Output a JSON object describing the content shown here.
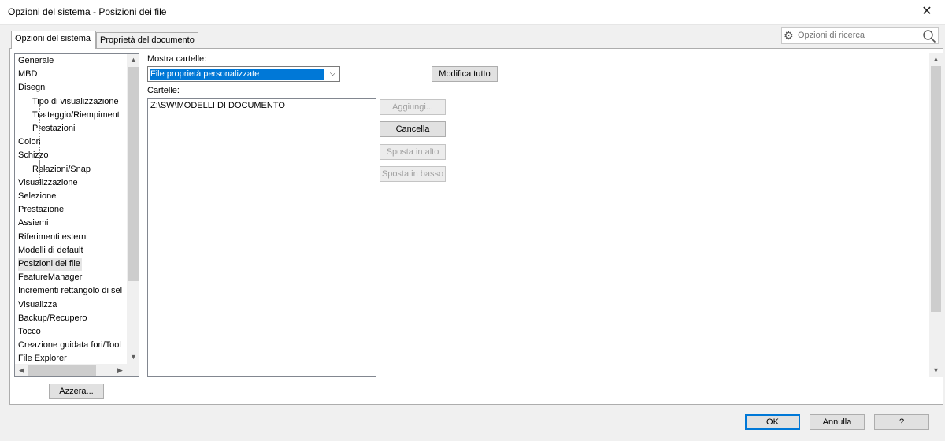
{
  "window": {
    "title": "Opzioni del sistema - Posizioni dei file",
    "close_icon": "close-icon"
  },
  "tabs": [
    {
      "label": "Opzioni del sistema",
      "active": true
    },
    {
      "label": "Proprietà del documento",
      "active": false
    }
  ],
  "search": {
    "placeholder": "Opzioni di ricerca"
  },
  "tree": {
    "items": [
      {
        "label": "Generale",
        "indent": 0
      },
      {
        "label": "MBD",
        "indent": 0
      },
      {
        "label": "Disegni",
        "indent": 0
      },
      {
        "label": "Tipo di visualizzazione",
        "indent": 1
      },
      {
        "label": "Tratteggio/Riempiment",
        "indent": 1
      },
      {
        "label": "Prestazioni",
        "indent": 1
      },
      {
        "label": "Colori",
        "indent": 0
      },
      {
        "label": "Schizzo",
        "indent": 0
      },
      {
        "label": "Relazioni/Snap",
        "indent": 1
      },
      {
        "label": "Visualizzazione",
        "indent": 0
      },
      {
        "label": "Selezione",
        "indent": 0
      },
      {
        "label": "Prestazione",
        "indent": 0
      },
      {
        "label": "Assiemi",
        "indent": 0
      },
      {
        "label": "Riferimenti esterni",
        "indent": 0
      },
      {
        "label": "Modelli di default",
        "indent": 0
      },
      {
        "label": "Posizioni dei file",
        "indent": 0,
        "selected": true
      },
      {
        "label": "FeatureManager",
        "indent": 0
      },
      {
        "label": "Incrementi rettangolo di sel",
        "indent": 0
      },
      {
        "label": "Visualizza",
        "indent": 0
      },
      {
        "label": "Backup/Recupero",
        "indent": 0
      },
      {
        "label": "Tocco",
        "indent": 0
      },
      {
        "label": "Creazione guidata fori/Tool",
        "indent": 0
      },
      {
        "label": "File Explorer",
        "indent": 0
      }
    ],
    "reset_button": "Azzera..."
  },
  "main": {
    "show_folders_label": "Mostra cartelle:",
    "show_folders_value": "File proprietà personalizzate",
    "edit_all_button": "Modifica tutto",
    "folders_label": "Cartelle:",
    "folders": [
      "Z:\\SW\\MODELLI DI DOCUMENTO"
    ],
    "buttons": {
      "add": "Aggiungi...",
      "delete": "Cancella",
      "move_up": "Sposta in alto",
      "move_down": "Sposta in basso"
    }
  },
  "footer": {
    "ok": "OK",
    "cancel": "Annulla",
    "help": "?"
  }
}
